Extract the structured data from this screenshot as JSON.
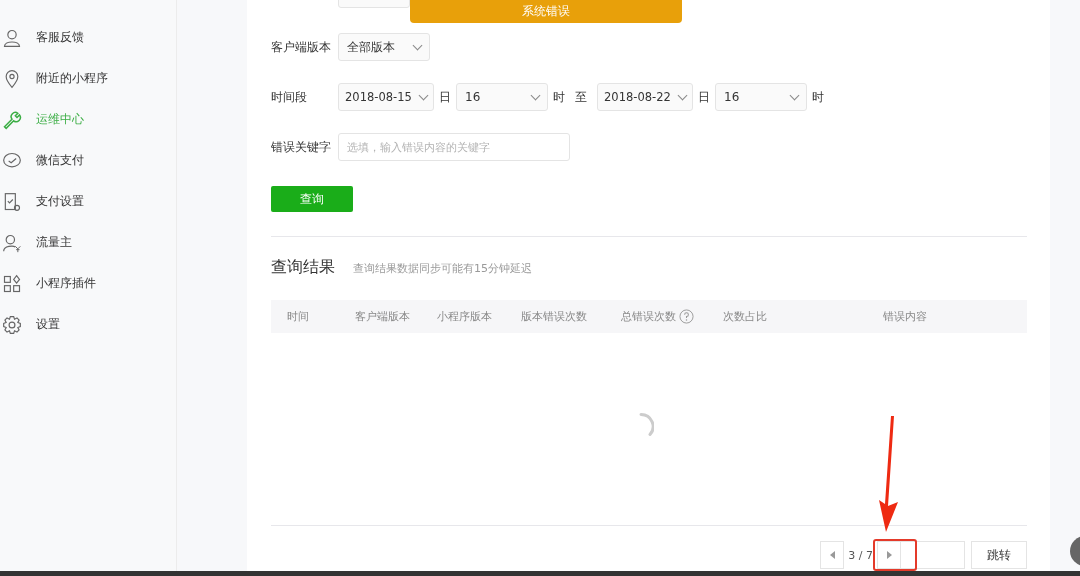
{
  "sidebar": {
    "items": [
      {
        "label": "客服反馈",
        "selected": false
      },
      {
        "label": "附近的小程序",
        "selected": false
      },
      {
        "label": "运维中心",
        "selected": true
      },
      {
        "label": "微信支付",
        "selected": false
      },
      {
        "label": "支付设置",
        "selected": false
      },
      {
        "label": "流量主",
        "selected": false
      },
      {
        "label": "小程序插件",
        "selected": false
      },
      {
        "label": "设置",
        "selected": false
      }
    ]
  },
  "alert": {
    "text": "系统错误"
  },
  "form": {
    "client_version": {
      "label": "客户端版本",
      "value": "全部版本"
    },
    "period": {
      "label": "时间段",
      "start_date": "2018-08-15",
      "day_unit_1": "日",
      "start_hour": "16",
      "hour_unit_1": "时",
      "to": "至",
      "end_date": "2018-08-22",
      "day_unit_2": "日",
      "end_hour": "16",
      "hour_unit_2": "时"
    },
    "keyword": {
      "label": "错误关键字",
      "placeholder": "选填，输入错误内容的关键字"
    },
    "query_button": "查询"
  },
  "results": {
    "title": "查询结果",
    "note": "查询结果数据同步可能有15分钟延迟",
    "columns": [
      {
        "label": "时间",
        "kind": "plain"
      },
      {
        "label": "客户端版本",
        "kind": "plain"
      },
      {
        "label": "小程序版本",
        "kind": "plain"
      },
      {
        "label": "版本错误次数",
        "kind": "plain"
      },
      {
        "label": "总错误次数",
        "kind": "help"
      },
      {
        "label": "次数占比",
        "kind": "plain"
      },
      {
        "label": "错误内容",
        "kind": "plain"
      }
    ]
  },
  "pagination": {
    "page": "3 / 7",
    "jump_button": "跳转"
  }
}
